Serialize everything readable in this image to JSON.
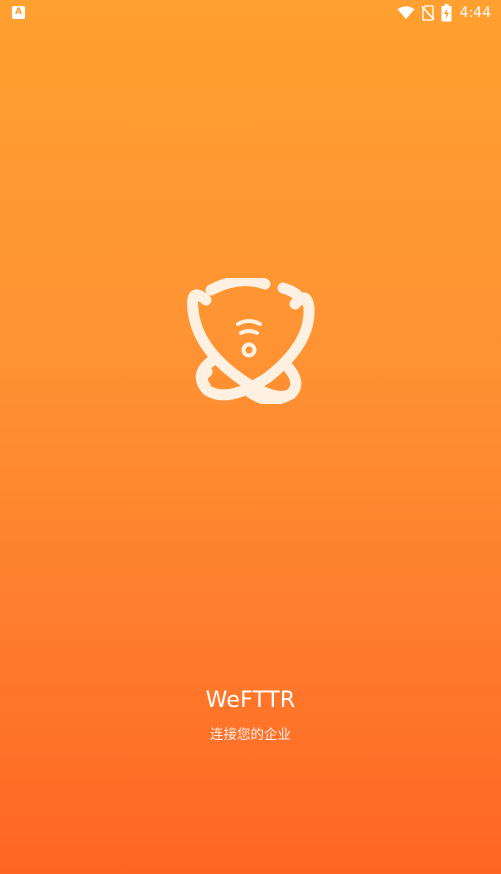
{
  "status_bar": {
    "notification_icon_label": "A",
    "time": "4:44",
    "icons": [
      "wifi-icon",
      "no-sim-icon",
      "battery-charging-icon"
    ]
  },
  "logo": {
    "icon": "atom-wifi-logo-icon",
    "color": "#FFF1E2"
  },
  "app": {
    "name": "WeFTTR",
    "tagline": "连接您的企业"
  },
  "colors": {
    "background_top": "#FFA030",
    "background_bottom": "#FF6622",
    "text": "#FFFFFF"
  }
}
